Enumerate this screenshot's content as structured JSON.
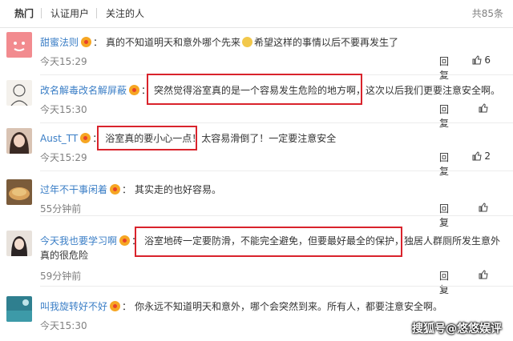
{
  "tabs": {
    "items": [
      "热门",
      "认证用户",
      "关注的人"
    ],
    "total": "共85条"
  },
  "comments": [
    {
      "user": "甜蜜法则",
      "text_a": "真的不知道明天和意外哪个先来",
      "text_b": "希望这样的事情以后不要再发生了",
      "time": "今天15:29",
      "reply": "回复",
      "likes": "6"
    },
    {
      "user": "改名解毒改名解屏蔽",
      "text": "突然觉得浴室真的是一个容易发生危险的地方啊，这次以后我们更要注意安全啊。",
      "time": "今天15:30",
      "reply": "回复",
      "likes": ""
    },
    {
      "user": "Aust_TT",
      "text": "浴室真的要小心一点！太容易滑倒了！一定要注意安全",
      "time": "今天15:29",
      "reply": "回复",
      "likes": "2"
    },
    {
      "user": "过年不干事闲着",
      "text": "其实走的也好容易。",
      "time": "55分钟前",
      "reply": "回复",
      "likes": ""
    },
    {
      "user": "今天我也要学习啊",
      "text": "浴室地砖一定要防滑，不能完全避免，但要最好最全的保护，独居人群厕所发生意外",
      "text2": "真的很危险",
      "time": "59分钟前",
      "reply": "回复",
      "likes": ""
    },
    {
      "user": "叫我旋转好不好",
      "text": "你永远不知道明天和意外，哪个会突然到来。所有人，都要注意安全啊。",
      "time": "今天15:30",
      "reply": "",
      "likes": ""
    }
  ],
  "watermark": "搜狐号@悠悠娱评",
  "colors": {
    "link": "#3a7ec6",
    "highlight_box": "#d9232c",
    "meta": "#808080"
  }
}
